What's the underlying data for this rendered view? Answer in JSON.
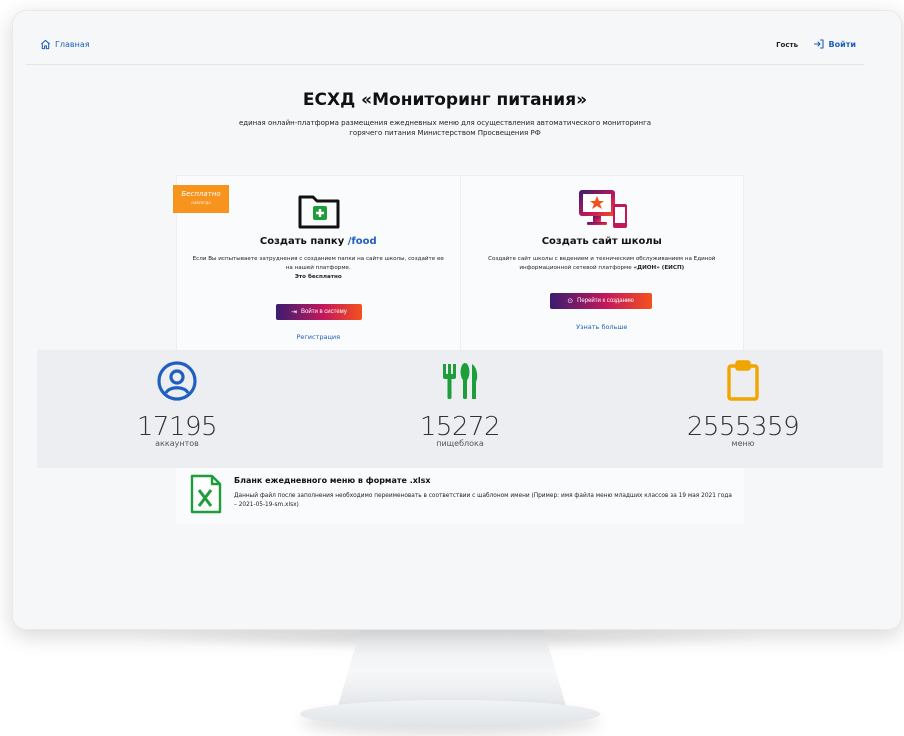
{
  "nav": {
    "home_label": "Главная",
    "guest_label": "Гость",
    "login_label": "Войти"
  },
  "hero": {
    "title": "ЕСХД «Мониторинг питания»",
    "subtitle": "единая онлайн-платформа размещения ежедневных меню для осуществления автоматического мониторинга горячего питания Министерством Просвещения РФ"
  },
  "card_folder": {
    "badge_main": "Бесплатно",
    "badge_sub": "навсегда",
    "title_prefix": "Создать папку ",
    "title_accent": "/food",
    "desc": "Если Вы испытываете затруднения с созданием папки на сайте школы, создайте ее на нашей платформе.",
    "desc_bold": "Это бесплатно",
    "button_label": "Войти в систему",
    "link_label": "Регистрация"
  },
  "card_site": {
    "title": "Создать сайт школы",
    "desc": "Создайте сайт школы с ведением и техническим обслуживанием на Единой информационной сетевой платформе ",
    "desc_bold": "«ДИОН» (ЕИСП)",
    "button_label": "Перейти к созданию",
    "link_label": "Узнать больше"
  },
  "stats": [
    {
      "icon": "user-circle-icon",
      "value": "17195",
      "label": "аккаунтов",
      "color": "#1f5fbf"
    },
    {
      "icon": "fork-knife-icon",
      "value": "15272",
      "label": "пищеблока",
      "color": "#1e9e3a"
    },
    {
      "icon": "clipboard-icon",
      "value": "2555359",
      "label": "меню",
      "color": "#f0a500"
    }
  ],
  "file": {
    "title": "Бланк ежедневного меню в формате .xlsx",
    "desc": "Данный файл после заполнения необходимо переименовать в соответствии с шаблоном имени (Пример: имя файла меню младших классов за 19 мая 2021 года – 2021-05-19-sm.xlsx)"
  },
  "colors": {
    "accent": "#1f5fbf",
    "badge": "#f7941d",
    "gradient_start": "#3a1c71",
    "gradient_mid": "#c2185b",
    "gradient_end": "#f4511e"
  }
}
